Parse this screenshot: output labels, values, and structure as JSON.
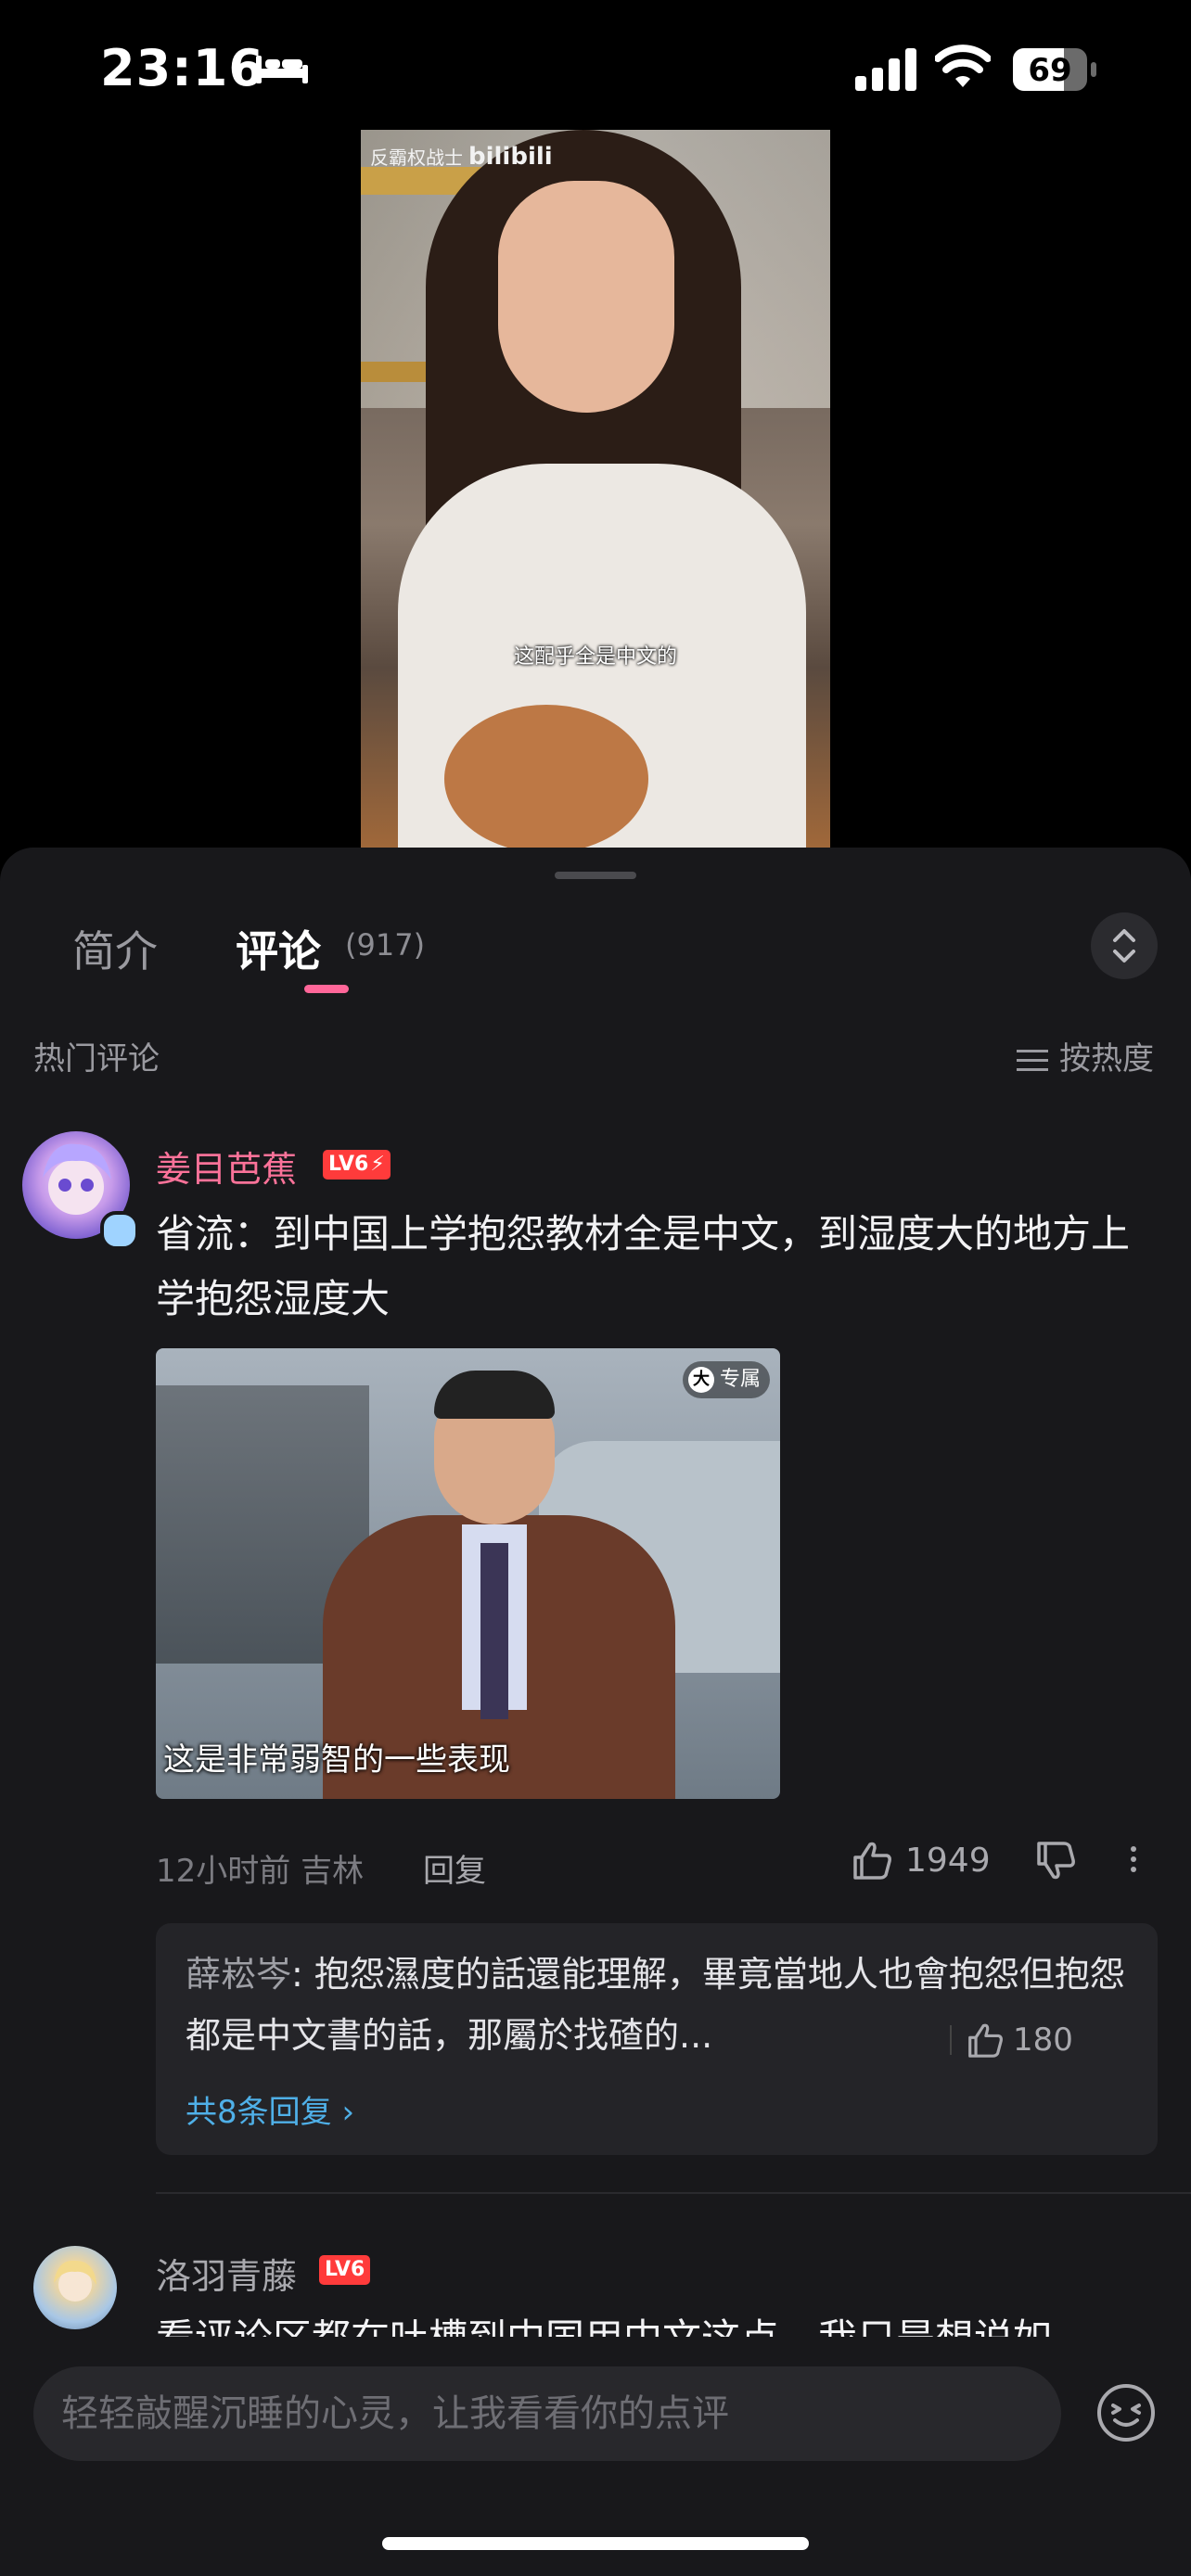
{
  "status_bar": {
    "time": "23:16",
    "battery": "69",
    "battery_level": 0.69
  },
  "video": {
    "watermark": "反霸权战士",
    "watermark_brand": "bilibili",
    "subtitle": "这配乎全是中文的"
  },
  "tabs": {
    "intro": "简介",
    "comments": "评论",
    "comments_count": "(917)"
  },
  "section": {
    "hot_label": "热门评论",
    "sort_label": "按热度"
  },
  "comments": [
    {
      "username": "姜目芭蕉",
      "level": "LV6",
      "text": "省流：到中国上学抱怨教材全是中文，到湿度大的地方上学抱怨湿度大",
      "image_tag": "专属",
      "image_tag_circle": "大",
      "image_caption": "这是非常弱智的一些表现",
      "meta": "12小时前  吉林",
      "reply_label": "回复",
      "likes": "1949",
      "sub_reply": {
        "author": "薛崧岑",
        "text": ": 抱怨濕度的話還能理解，畢竟當地人也會抱怨但抱怨都是中文書的話，那屬於找碴的...",
        "likes": "180"
      },
      "view_replies": "共8条回复"
    },
    {
      "username": "洛羽青藤",
      "level": "LV6",
      "text": "看评论区都在吐槽到中国用中文这点，我只是想说如"
    }
  ],
  "input": {
    "placeholder": "轻轻敲醒沉睡的心灵，让我看看你的点评"
  },
  "colors": {
    "accent": "#fb7299",
    "link": "#4fb0e8",
    "background": "#18181b"
  }
}
